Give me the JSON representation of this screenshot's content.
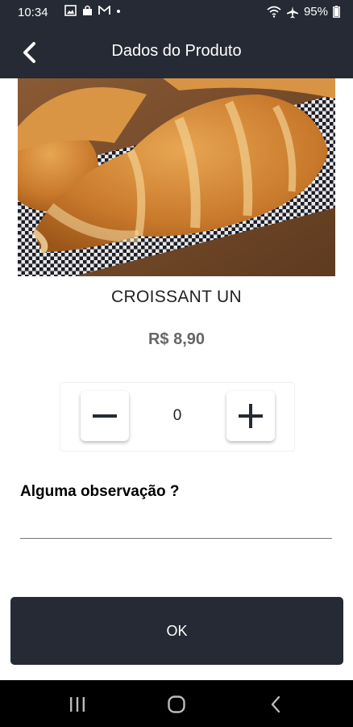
{
  "status_bar": {
    "time": "10:34",
    "battery": "95%",
    "icons": [
      "image-icon",
      "bag-icon",
      "gmail-icon",
      "dot-icon",
      "wifi-icon",
      "airplane-icon",
      "battery-icon"
    ]
  },
  "app_bar": {
    "title": "Dados do Produto",
    "back_icon": "chevron-left-icon"
  },
  "product": {
    "image": "croissant-photo",
    "name": "CROISSANT UN",
    "price": "R$ 8,90"
  },
  "quantity": {
    "value": "0",
    "minus_icon": "minus-icon",
    "plus_icon": "plus-icon"
  },
  "observation": {
    "label": "Alguma observação ?",
    "value": "",
    "placeholder": ""
  },
  "ok_button": {
    "label": "OK"
  },
  "nav_bar": {
    "items": [
      "recents-icon",
      "home-icon",
      "back-icon"
    ]
  },
  "colors": {
    "header_bg": "#252a34",
    "button_bg": "#252a34",
    "price_text": "#666666"
  }
}
